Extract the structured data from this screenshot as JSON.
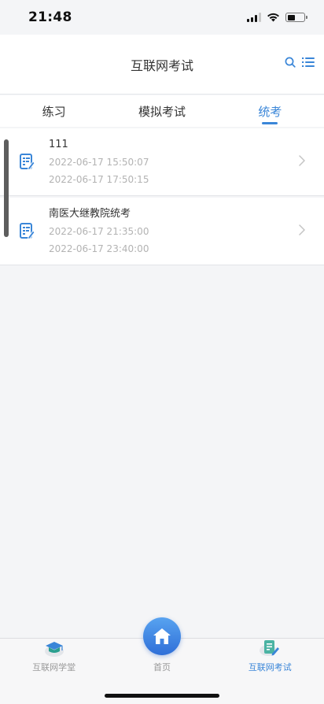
{
  "status_bar": {
    "time": "21:48"
  },
  "header": {
    "title": "互联网考试",
    "search_icon": "search-icon",
    "menu_icon": "list-menu-icon"
  },
  "tabs": [
    {
      "label": "练习",
      "active": false
    },
    {
      "label": "模拟考试",
      "active": false
    },
    {
      "label": "统考",
      "active": true
    }
  ],
  "exams": [
    {
      "name": "111",
      "start": "2022-06-17 15:50:07",
      "end": "2022-06-17 17:50:15",
      "icon": "exam-paper-icon"
    },
    {
      "name": "南医大继教院统考",
      "start": "2022-06-17 21:35:00",
      "end": "2022-06-17 23:40:00",
      "icon": "exam-paper-icon"
    }
  ],
  "bottom_nav": {
    "left": {
      "label": "互联网学堂",
      "icon": "graduation-cap-icon"
    },
    "center": {
      "label": "首页",
      "icon": "home-icon"
    },
    "right": {
      "label": "互联网考试",
      "icon": "exam-clipboard-icon",
      "active": true
    }
  },
  "colors": {
    "accent": "#3a86d8",
    "muted_text": "#b3b3b3",
    "background": "#f4f5f7"
  }
}
